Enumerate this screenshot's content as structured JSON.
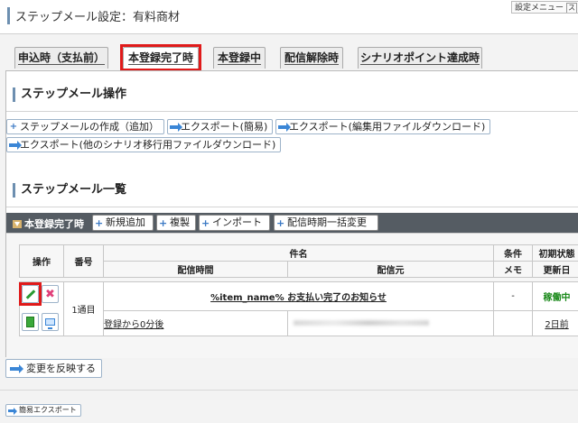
{
  "header": {
    "title": "ステップメール設定：有料商材",
    "settings_menu": "設定メニュー",
    "settings_menu_icon": "ス"
  },
  "tabs": [
    {
      "label": "申込時（支払前）"
    },
    {
      "label": "本登録完了時",
      "active": true
    },
    {
      "label": "本登録中"
    },
    {
      "label": "配信解除時"
    },
    {
      "label": "シナリオポイント達成時"
    }
  ],
  "operations": {
    "title": "ステップメール操作",
    "buttons": [
      {
        "label": "ステップメールの作成（追加）",
        "icon": "plus-icon"
      },
      {
        "label": "エクスポート(簡易)",
        "icon": "arrow-right-icon"
      },
      {
        "label": "エクスポート(編集用ファイルダウンロード)",
        "icon": "arrow-right-icon"
      },
      {
        "label": "エクスポート(他のシナリオ移行用ファイルダウンロード)",
        "icon": "arrow-right-icon"
      }
    ]
  },
  "list": {
    "title": "ステップメール一覧",
    "group_label": "本登録完了時",
    "bar_buttons": [
      {
        "label": "新規追加"
      },
      {
        "label": "複製"
      },
      {
        "label": "インポート"
      },
      {
        "label": "配信時期一括変更"
      }
    ],
    "columns": {
      "operation": "操作",
      "number": "番号",
      "subject": "件名",
      "send_time": "配信時間",
      "sender": "配信元",
      "condition": "条件",
      "memo": "メモ",
      "initial_status": "初期状態",
      "updated": "更新日"
    },
    "rows": [
      {
        "number": "1通目",
        "subject": "%item_name% お支払い完了のお知らせ",
        "condition": "-",
        "status": "稼働中",
        "send_time": "登録から0分後",
        "updated": "2日前"
      }
    ]
  },
  "footer": {
    "reflect_button": "変更を反映する",
    "simple_export": "簡易エクスポート"
  },
  "colors": {
    "accent_red": "#e01a1a",
    "bar_dark": "#555c63",
    "status_green": "#1c8a1c",
    "icon_blue": "#3b86d6"
  }
}
